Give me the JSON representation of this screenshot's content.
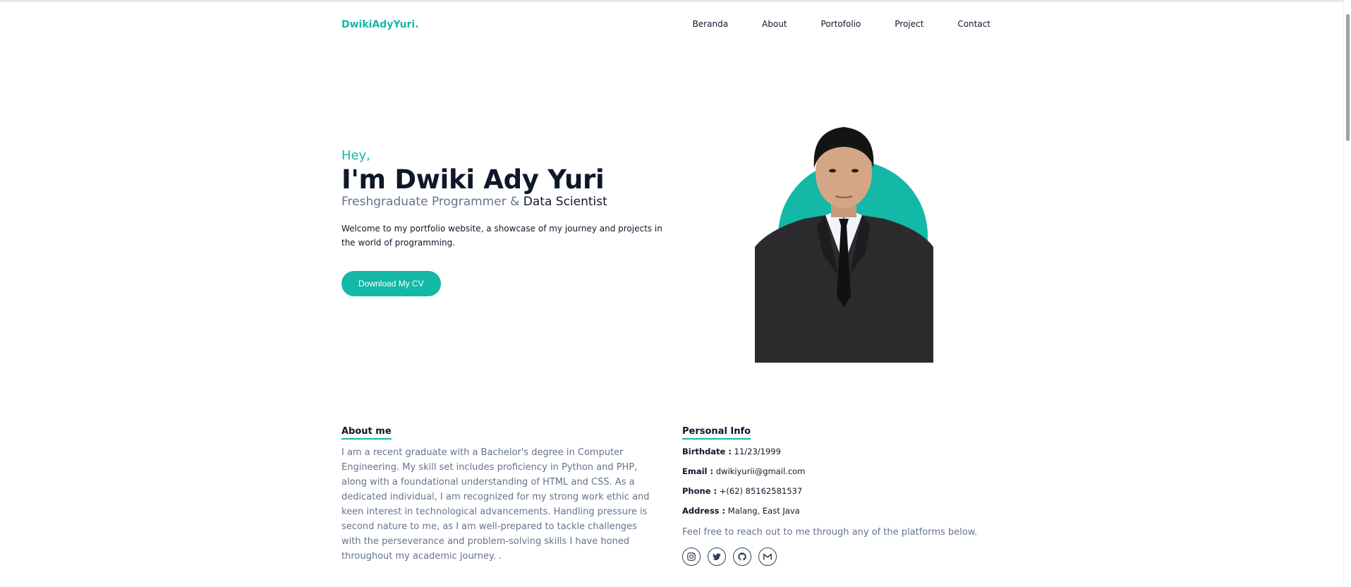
{
  "nav": {
    "brand": "DwikiAdyYuri.",
    "links": [
      "Beranda",
      "About",
      "Portofolio",
      "Project",
      "Contact"
    ]
  },
  "hero": {
    "greeting": "Hey,",
    "title": "I'm Dwiki Ady Yuri",
    "subtitle_part1": "Freshgraduate Programmer",
    "subtitle_amp": "&",
    "subtitle_part2": "Data Scientist",
    "description": "Welcome to my portfolio website, a showcase of my journey and projects in the world of programming.",
    "cv_button": "Download My CV"
  },
  "about": {
    "heading": "About me",
    "text": "I am a recent graduate with a Bachelor's degree in Computer Engineering. My skill set includes proficiency in Python and PHP, along with a foundational understanding of HTML and CSS. As a dedicated individual, I am recognized for my strong work ethic and keen interest in technological advancements. Handling pressure is second nature to me, as I am well-prepared to tackle challenges with the perseverance and problem-solving skills I have honed throughout my academic journey. ."
  },
  "personal": {
    "heading": "Personal Info",
    "birthdate_label": "Birthdate :",
    "birthdate": "11/23/1999",
    "email_label": "Email :",
    "email": "dwikiyurii@gmail.com",
    "phone_label": "Phone :",
    "phone": "+(62) 85162581537",
    "address_label": "Address :",
    "address": "Malang, East Java",
    "reach": "Feel free to reach out to me through any of the platforms below.",
    "socials": [
      "instagram-icon",
      "twitter-icon",
      "github-icon",
      "gmail-icon"
    ]
  },
  "colors": {
    "accent": "#14b8a6",
    "text": "#0f172a",
    "muted": "#64748b"
  }
}
